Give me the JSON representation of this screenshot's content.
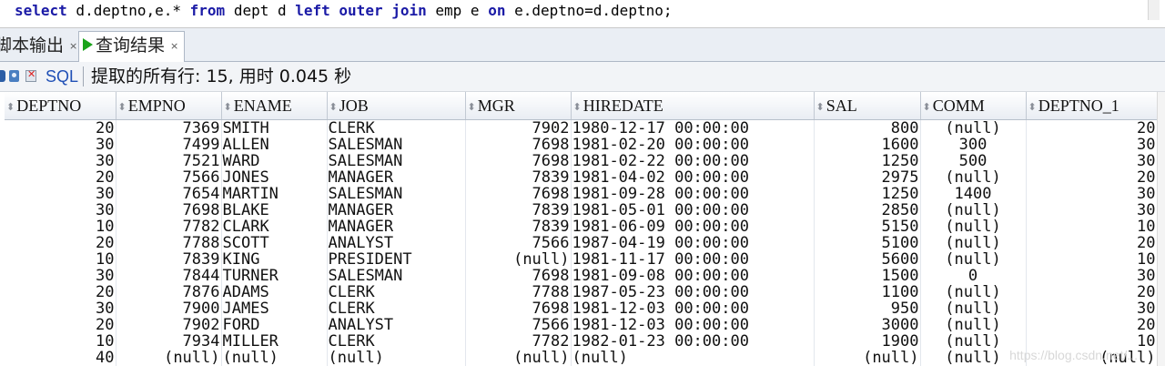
{
  "editor": {
    "sql_tokens": [
      {
        "t": "select",
        "kw": true
      },
      {
        "t": " d.deptno,e.* ",
        "kw": false
      },
      {
        "t": "from",
        "kw": true
      },
      {
        "t": " dept d ",
        "kw": false
      },
      {
        "t": "left outer join",
        "kw": true
      },
      {
        "t": " emp e ",
        "kw": false
      },
      {
        "t": "on",
        "kw": true
      },
      {
        "t": " e.deptno=d.deptno;",
        "kw": false
      }
    ]
  },
  "tabs": {
    "inactive_label": "脚本输出",
    "active_label": "查询结果",
    "close_glyph": "×"
  },
  "toolbar": {
    "sql_label": "SQL",
    "status": "提取的所有行: 15, 用时 0.045 秒"
  },
  "grid": {
    "columns": [
      "DEPTNO",
      "EMPNO",
      "ENAME",
      "JOB",
      "MGR",
      "HIREDATE",
      "SAL",
      "COMM",
      "DEPTNO_1"
    ],
    "rows": [
      [
        "20",
        "7369",
        "SMITH",
        "CLERK",
        "7902",
        "1980-12-17 00:00:00",
        "800",
        "(null)",
        "20"
      ],
      [
        "30",
        "7499",
        "ALLEN",
        "SALESMAN",
        "7698",
        "1981-02-20 00:00:00",
        "1600",
        "300",
        "30"
      ],
      [
        "30",
        "7521",
        "WARD",
        "SALESMAN",
        "7698",
        "1981-02-22 00:00:00",
        "1250",
        "500",
        "30"
      ],
      [
        "20",
        "7566",
        "JONES",
        "MANAGER",
        "7839",
        "1981-04-02 00:00:00",
        "2975",
        "(null)",
        "20"
      ],
      [
        "30",
        "7654",
        "MARTIN",
        "SALESMAN",
        "7698",
        "1981-09-28 00:00:00",
        "1250",
        "1400",
        "30"
      ],
      [
        "30",
        "7698",
        "BLAKE",
        "MANAGER",
        "7839",
        "1981-05-01 00:00:00",
        "2850",
        "(null)",
        "30"
      ],
      [
        "10",
        "7782",
        "CLARK",
        "MANAGER",
        "7839",
        "1981-06-09 00:00:00",
        "5150",
        "(null)",
        "10"
      ],
      [
        "20",
        "7788",
        "SCOTT",
        "ANALYST",
        "7566",
        "1987-04-19 00:00:00",
        "5100",
        "(null)",
        "20"
      ],
      [
        "10",
        "7839",
        "KING",
        "PRESIDENT",
        "(null)",
        "1981-11-17 00:00:00",
        "5600",
        "(null)",
        "10"
      ],
      [
        "30",
        "7844",
        "TURNER",
        "SALESMAN",
        "7698",
        "1981-09-08 00:00:00",
        "1500",
        "0",
        "30"
      ],
      [
        "20",
        "7876",
        "ADAMS",
        "CLERK",
        "7788",
        "1987-05-23 00:00:00",
        "1100",
        "(null)",
        "20"
      ],
      [
        "30",
        "7900",
        "JAMES",
        "CLERK",
        "7698",
        "1981-12-03 00:00:00",
        "950",
        "(null)",
        "30"
      ],
      [
        "20",
        "7902",
        "FORD",
        "ANALYST",
        "7566",
        "1981-12-03 00:00:00",
        "3000",
        "(null)",
        "20"
      ],
      [
        "10",
        "7934",
        "MILLER",
        "CLERK",
        "7782",
        "1982-01-23 00:00:00",
        "1900",
        "(null)",
        "10"
      ],
      [
        "40",
        "(null)",
        "(null)",
        "(null)",
        "(null)",
        "(null)",
        "(null)",
        "(null)",
        "(null)"
      ]
    ]
  },
  "watermark": "https://blog.csdn.net/..."
}
